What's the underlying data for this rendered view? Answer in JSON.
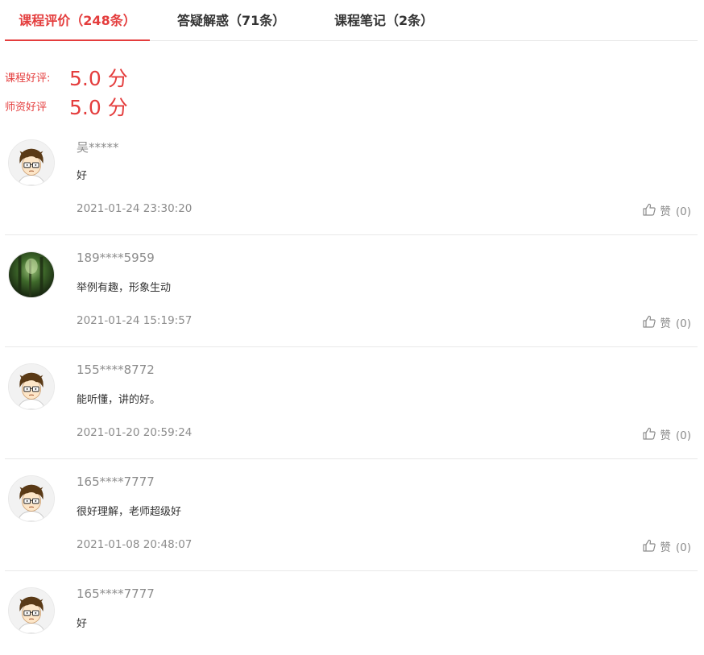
{
  "tabs": [
    {
      "label": "课程评价（248条）",
      "active": true
    },
    {
      "label": "答疑解惑（71条）",
      "active": false
    },
    {
      "label": "课程笔记（2条）",
      "active": false
    }
  ],
  "ratings": {
    "course": {
      "label": "课程好评:",
      "score": "5.0 分"
    },
    "teacher": {
      "label": "师资好评",
      "score": "5.0 分"
    }
  },
  "colors": {
    "accent": "#e43d3d",
    "muted": "#8c8c8c",
    "divider": "#e8e8e8"
  },
  "like_label": "赞",
  "reviews": [
    {
      "user": "吴*****",
      "avatar": "cartoon-boy-avatar",
      "content": "好",
      "time": "2021-01-24 23:30:20",
      "likes": "(0)"
    },
    {
      "user": "189****5959",
      "avatar": "forest-photo-avatar",
      "content": "举例有趣，形象生动",
      "time": "2021-01-24 15:19:57",
      "likes": "(0)"
    },
    {
      "user": "155****8772",
      "avatar": "cartoon-boy-avatar",
      "content": "能听懂，讲的好。",
      "time": "2021-01-20 20:59:24",
      "likes": "(0)"
    },
    {
      "user": "165****7777",
      "avatar": "cartoon-boy-avatar",
      "content": "很好理解，老师超级好",
      "time": "2021-01-08 20:48:07",
      "likes": "(0)"
    },
    {
      "user": "165****7777",
      "avatar": "cartoon-boy-avatar",
      "content": "好",
      "time": "",
      "likes": ""
    }
  ]
}
